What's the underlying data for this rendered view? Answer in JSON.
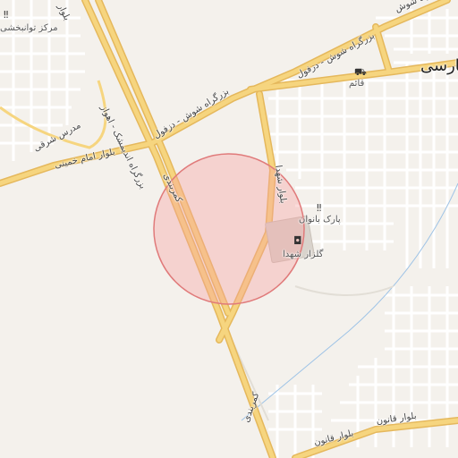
{
  "map": {
    "labels": {
      "shush_dezful_1": "بزرگراه شوش - دزفول",
      "shush_dezful_2": "بزرگراه شوش - دزفول",
      "shush_top": "بزرگراه شوش",
      "andimeshk_ahvaz": "بزرگراه اندیمشک - اهواز",
      "kamarbandi_1": "کمربندی",
      "kamarbandi_2": "کمربندی",
      "shohada_blvd": "بلوار شهدا",
      "park_banovan": "پارک بانوان",
      "golzar_shohada": "گلزار شهدا",
      "ghaem": "قائم",
      "imam_khomeini": "بلوار امام خمینی",
      "madres_sharghi": "مدرس شرقی",
      "tavanbakhshi": "مرکز توانبخشی",
      "blvd_top_left": "بلوار",
      "qanun_1": "بلوار قانون",
      "qanun_2": "بلوار قانون",
      "farsi": "فارسی"
    },
    "icons": {
      "tavanbakhshi": "hospital-icon",
      "ghaem": "shop-icon",
      "park_banovan": "hospital-icon",
      "golzar_shohada": "monument-icon"
    },
    "colors": {
      "background": "#f4f1ec",
      "major_road": "#f6d57f",
      "major_road_casing": "#e5b85c",
      "minor_road": "#ffffff",
      "highlight_fill": "#f7a1a1",
      "highlight_stroke": "#e07a7a"
    }
  }
}
